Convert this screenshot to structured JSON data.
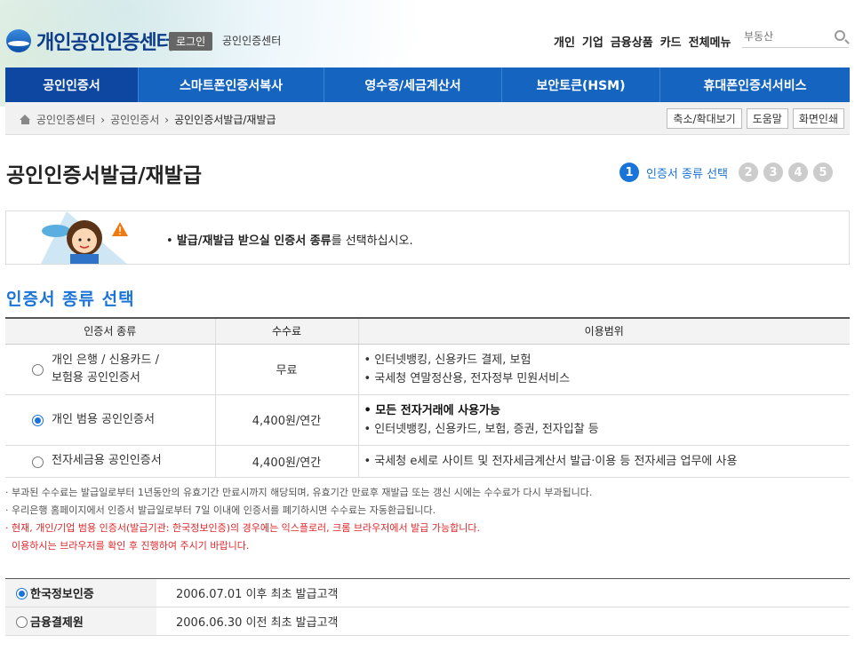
{
  "header": {
    "logo_text": "개인공인인증센터",
    "login_label": "로그인",
    "center_link": "공인인증센터",
    "top_menu": [
      "개인",
      "기업",
      "금융상품",
      "카드",
      "전체메뉴"
    ],
    "search_placeholder": "부동산"
  },
  "nav": {
    "items": [
      "공인인증서",
      "스마트폰인증서복사",
      "영수증/세금계산서",
      "보안토큰(HSM)",
      "휴대폰인증서서비스"
    ],
    "active_index": 0
  },
  "breadcrumb": {
    "items": [
      "공인인증센터",
      "공인인증서",
      "공인인증서발급/재발급"
    ],
    "buttons": [
      "축소/확대보기",
      "도움말",
      "화면인쇄"
    ]
  },
  "page": {
    "title": "공인인증서발급/재발급",
    "steps": [
      "1",
      "2",
      "3",
      "4",
      "5"
    ],
    "active_step_label": "인증서 종류 선택",
    "info_text_prefix": "• ",
    "info_text_bold": "발급/재발급 받으실 인증서 종류",
    "info_text_rest": "를 선택하십시오."
  },
  "section": {
    "title": "인증서 종류 선택",
    "columns": [
      "인증서 종류",
      "수수료",
      "이용범위"
    ],
    "rows": [
      {
        "type": [
          "개인 은행 / 신용카드 /",
          "보험용 공인인증서"
        ],
        "fee": "무료",
        "use_bold": "",
        "use": [
          "• 인터넷뱅킹, 신용카드 결제, 보험",
          "• 국세청 연말정산용, 전자정부 민원서비스"
        ],
        "selected": false
      },
      {
        "type": [
          "개인 범용 공인인증서"
        ],
        "fee": "4,400원/연간",
        "use_bold": "• 모든 전자거래에 사용가능",
        "use": [
          "• 인터넷뱅킹, 신용카드, 보험, 증권, 전자입찰 등"
        ],
        "selected": true
      },
      {
        "type": [
          "전자세금용 공인인증서"
        ],
        "fee": "4,400원/연간",
        "use_bold": "",
        "use": [
          "• 국세청 e세로 사이트 및 전자세금계산서 발급·이용 등 전자세금 업무에 사용"
        ],
        "selected": false
      }
    ]
  },
  "notes": [
    "· 부과된 수수료는 발급일로부터 1년동안의 유효기간 만료시까지 해당되며, 유효기간 만료후 재발급 또는 갱신 시에는 수수료가 다시 부과됩니다.",
    "· 우리은행 홈페이지에서 인증서 발급일로부터 7일 이내에 인증서를 폐기하시면 수수료는 자동환급됩니다.",
    "· 현재, 개인/기업 범용 인증서(발급기관: 한국정보인증)의 경우에는 익스플로러, 크롬 브라우저에서 발급 가능합니다.",
    "  이용하시는 브라우저를 확인 후 진행하여 주시기 바랍니다."
  ],
  "issuer": {
    "rows": [
      {
        "name": "한국정보인증",
        "desc": "2006.07.01 이후 최초 발급고객",
        "selected": true
      },
      {
        "name": "금융결제원",
        "desc": "2006.06.30 이전 최초 발급고객",
        "selected": false
      }
    ]
  },
  "colors": {
    "nav_bg": "#1565c0",
    "accent": "#1a73d8",
    "warning": "#e0262a"
  }
}
